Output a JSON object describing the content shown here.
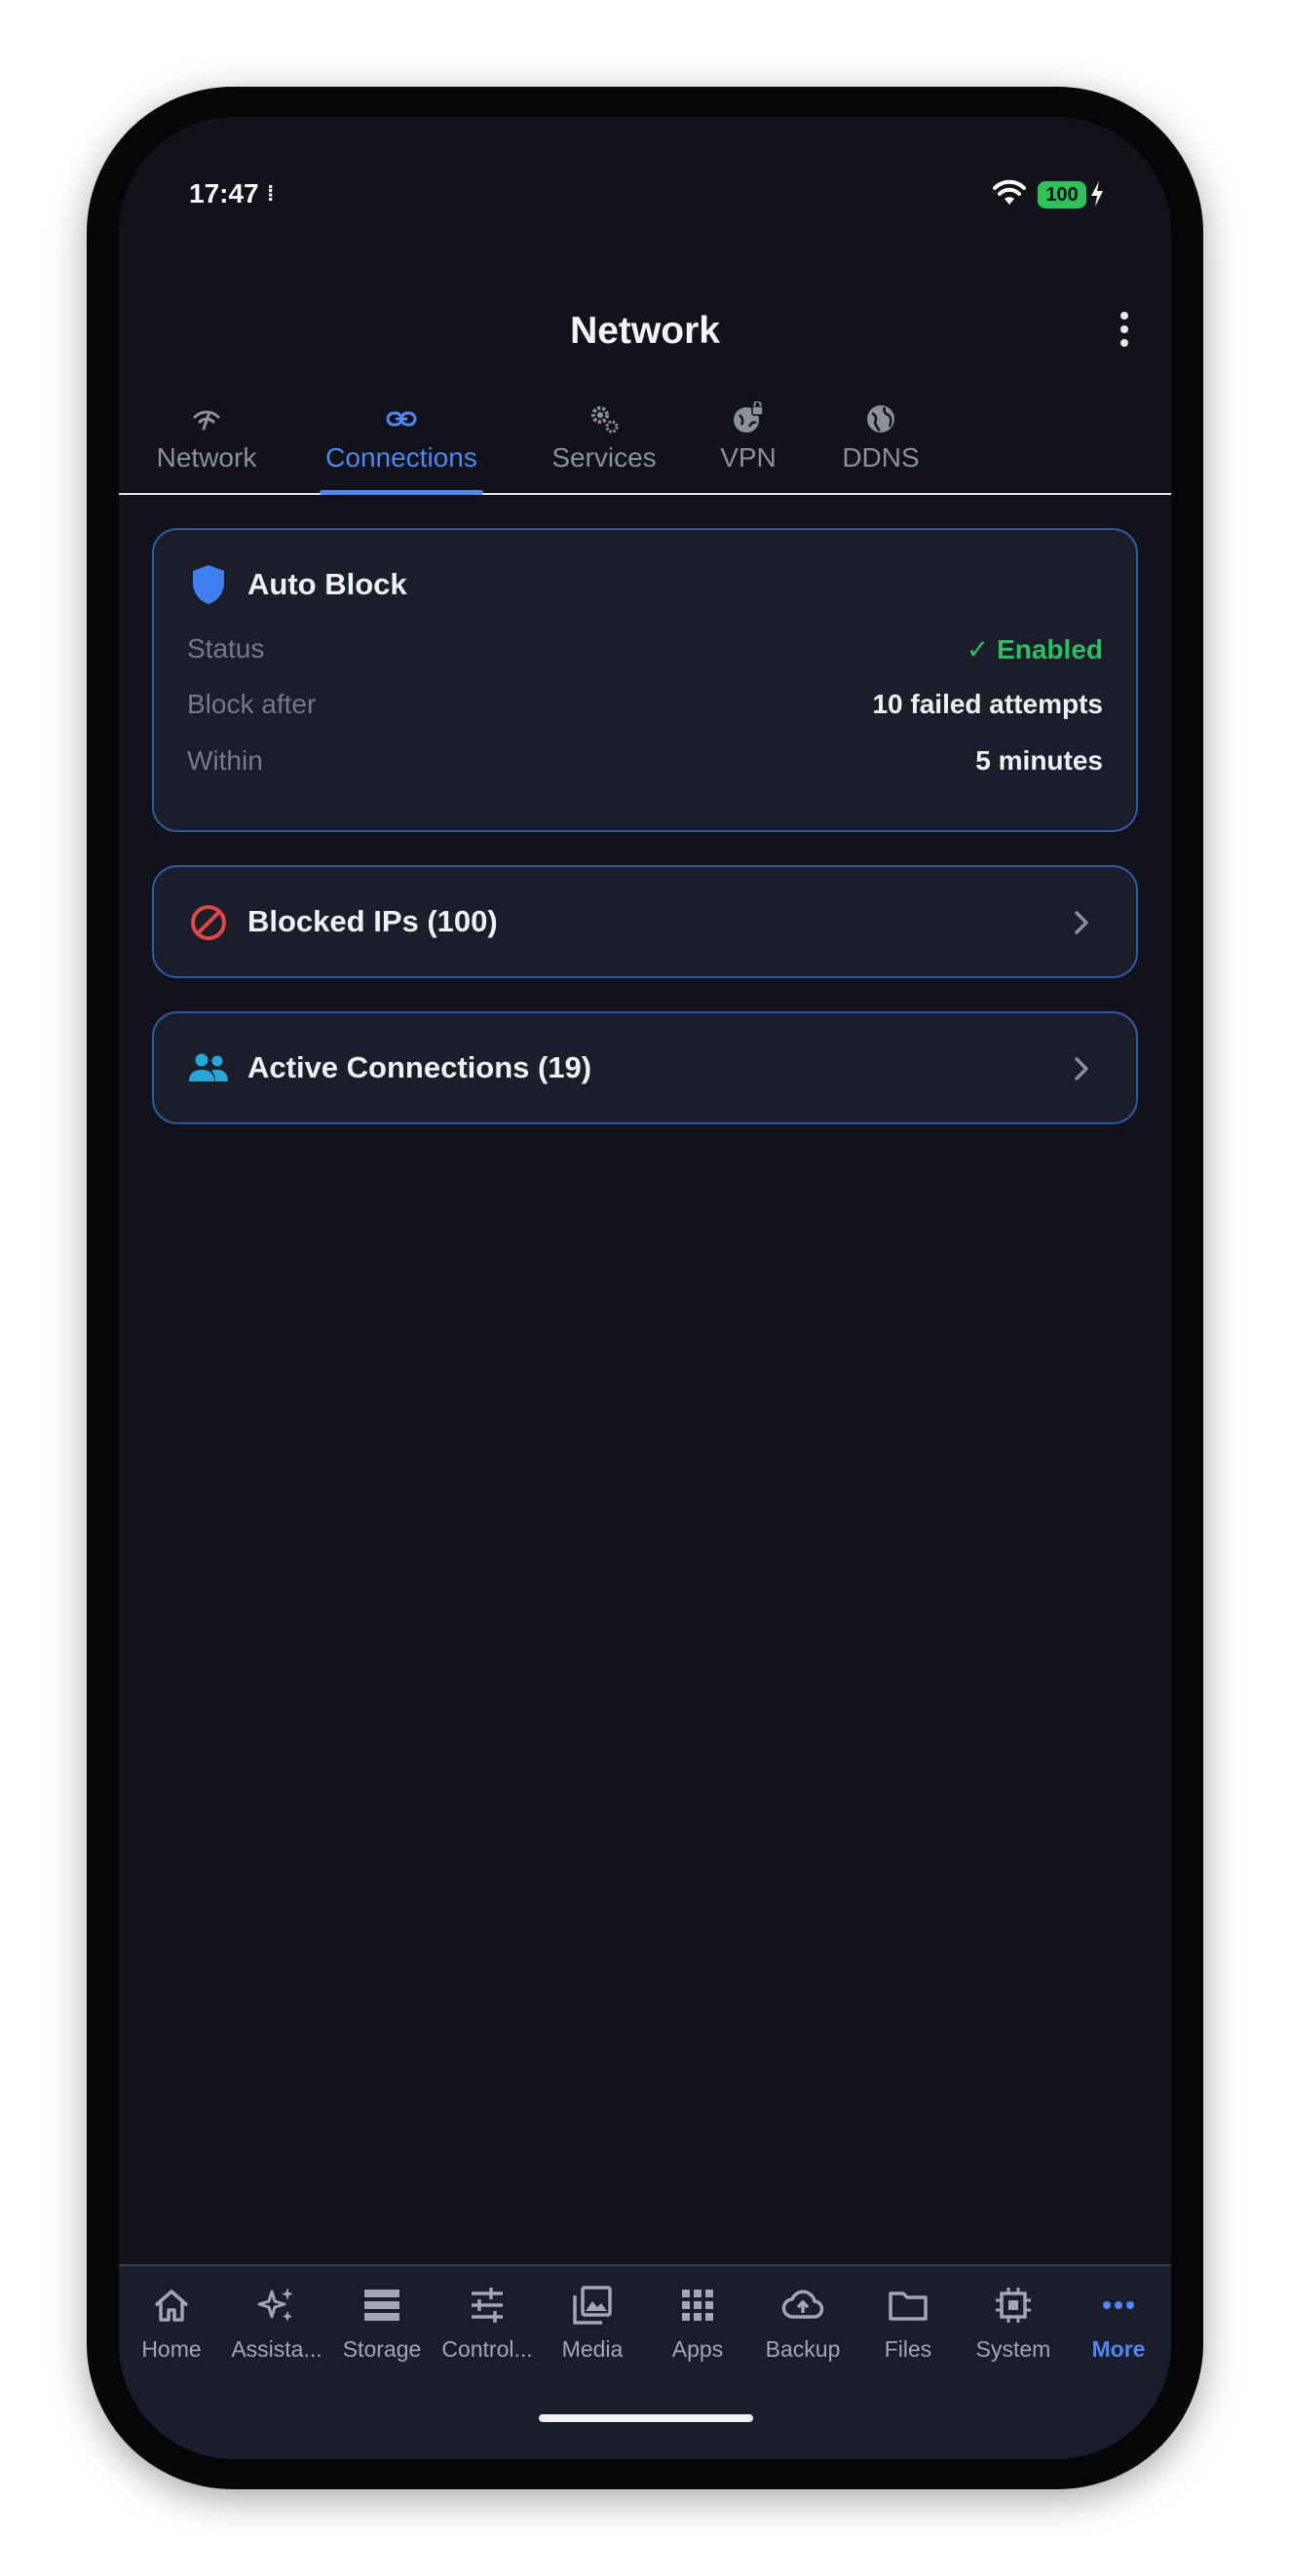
{
  "status_bar": {
    "time": "17:47",
    "time_extra": "⁞",
    "battery": "100"
  },
  "header": {
    "title": "Network",
    "menu_icon": "more-vertical-icon"
  },
  "tabs": [
    {
      "label": "Network",
      "icon": "wifi-signal-icon",
      "active": false
    },
    {
      "label": "Connections",
      "icon": "link-icon",
      "active": true
    },
    {
      "label": "Services",
      "icon": "gears-icon",
      "active": false
    },
    {
      "label": "VPN",
      "icon": "globe-lock-icon",
      "active": false
    },
    {
      "label": "DDNS",
      "icon": "globe-icon",
      "active": false
    }
  ],
  "auto_block": {
    "title": "Auto Block",
    "icon": "shield-icon",
    "rows": [
      {
        "label": "Status",
        "value": "✓ Enabled",
        "color": "#2fbd63"
      },
      {
        "label": "Block after",
        "value": "10 failed attempts"
      },
      {
        "label": "Within",
        "value": "5 minutes"
      }
    ]
  },
  "blocked_ips": {
    "label": "Blocked IPs (100)",
    "icon": "block-icon",
    "color": "#e04848"
  },
  "active_connections": {
    "label": "Active Connections (19)",
    "icon": "people-icon",
    "color": "#27a6d8"
  },
  "bottom_nav": [
    {
      "label": "Home",
      "icon": "home-icon"
    },
    {
      "label": "Assista...",
      "icon": "sparkle-icon"
    },
    {
      "label": "Storage",
      "icon": "storage-icon"
    },
    {
      "label": "Control...",
      "icon": "sliders-icon"
    },
    {
      "label": "Media",
      "icon": "photo-library-icon"
    },
    {
      "label": "Apps",
      "icon": "apps-grid-icon"
    },
    {
      "label": "Backup",
      "icon": "cloud-upload-icon"
    },
    {
      "label": "Files",
      "icon": "folder-icon"
    },
    {
      "label": "System",
      "icon": "chip-icon"
    },
    {
      "label": "More",
      "icon": "more-horizontal-icon",
      "active": true
    }
  ],
  "colors": {
    "accent": "#4f86ef",
    "background": "#11121a",
    "card": "#1b1d2b",
    "card_border": "#2f5ba4",
    "success": "#2fbd63"
  }
}
